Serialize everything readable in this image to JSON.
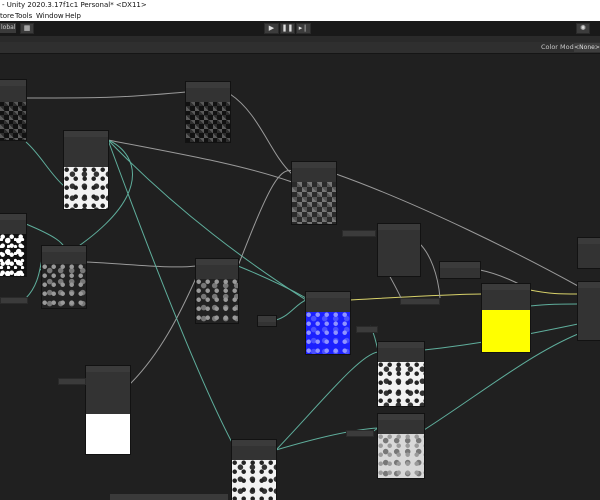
{
  "titlebar": {
    "text": "- Unity 2020.3.17f1c1 Personal* <DX11>"
  },
  "menubar": {
    "items": [
      "tore",
      "Tools",
      "Window",
      "Help"
    ]
  },
  "toolbar": {
    "global_label": "lobal",
    "play_glyph": "▶",
    "pause_glyph": "❚❚",
    "step_glyph": "▸❘"
  },
  "tabbar": {
    "color_mode_label": "Color Mode",
    "color_mode_value": "<None>"
  },
  "colors": {
    "wire_gray": "#9a9a9a",
    "wire_teal": "#5fae9c",
    "wire_yellow": "#d8d26a",
    "preview_blue": "#1b20ff",
    "preview_yellow": "#ffff00"
  }
}
